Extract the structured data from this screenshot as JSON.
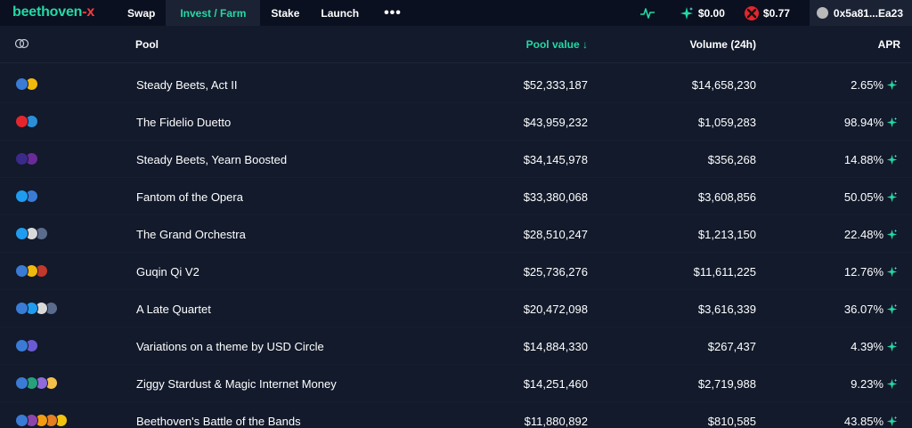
{
  "brand": {
    "part1": "beethoven",
    "part2": "-x"
  },
  "nav": [
    {
      "label": "Swap",
      "active": false
    },
    {
      "label": "Invest / Farm",
      "active": true
    },
    {
      "label": "Stake",
      "active": false
    },
    {
      "label": "Launch",
      "active": false
    }
  ],
  "nav_more": "•••",
  "tools": {
    "rewards": "$0.00",
    "beets_price": "$0.77",
    "wallet": "0x5a81...Ea23"
  },
  "colors": {
    "accent": "#24d9a4",
    "brand_x": "#ff3b3b",
    "background": "#0b1020",
    "panel": "#121a2b"
  },
  "columns": {
    "pool": "Pool",
    "pool_value": "Pool value ↓",
    "volume": "Volume (24h)",
    "apr": "APR"
  },
  "pools": [
    {
      "name": "Steady Beets, Act II",
      "value": "$52,333,187",
      "volume": "$14,658,230",
      "apr": "2.65%",
      "tokens": [
        "#3a7bd5",
        "#f0b90b"
      ]
    },
    {
      "name": "The Fidelio Duetto",
      "value": "$43,959,232",
      "volume": "$1,059,283",
      "apr": "98.94%",
      "tokens": [
        "#e3262d",
        "#2b8ed8"
      ]
    },
    {
      "name": "Steady Beets, Yearn Boosted",
      "value": "$34,145,978",
      "volume": "$356,268",
      "apr": "14.88%",
      "tokens": [
        "#3b2a8a",
        "#6a2a9a"
      ]
    },
    {
      "name": "Fantom of the Opera",
      "value": "$33,380,068",
      "volume": "$3,608,856",
      "apr": "50.05%",
      "tokens": [
        "#1f9cf0",
        "#3a7bd5"
      ]
    },
    {
      "name": "The Grand Orchestra",
      "value": "$28,510,247",
      "volume": "$1,213,150",
      "apr": "22.48%",
      "tokens": [
        "#1f9cf0",
        "#d9d9d9",
        "#5a6b8c"
      ]
    },
    {
      "name": "Guqin Qi V2",
      "value": "$25,736,276",
      "volume": "$11,611,225",
      "apr": "12.76%",
      "tokens": [
        "#3a7bd5",
        "#f0b90b",
        "#c0392b"
      ]
    },
    {
      "name": "A Late Quartet",
      "value": "$20,472,098",
      "volume": "$3,616,339",
      "apr": "36.07%",
      "tokens": [
        "#3a7bd5",
        "#1f9cf0",
        "#d9d9d9",
        "#5a6b8c"
      ]
    },
    {
      "name": "Variations on a theme by USD Circle",
      "value": "$14,884,330",
      "volume": "$267,437",
      "apr": "4.39%",
      "tokens": [
        "#3a7bd5",
        "#6b5bd2"
      ]
    },
    {
      "name": "Ziggy Stardust & Magic Internet Money",
      "value": "$14,251,460",
      "volume": "$2,719,988",
      "apr": "9.23%",
      "tokens": [
        "#3a7bd5",
        "#26a17b",
        "#8e6bd8",
        "#f5c04a"
      ]
    },
    {
      "name": "Beethoven's Battle of the Bands",
      "value": "$11,880,892",
      "volume": "$810,585",
      "apr": "43.85%",
      "tokens": [
        "#3a7bd5",
        "#8e44ad",
        "#f39c12",
        "#e67e22",
        "#f1c40f"
      ]
    }
  ]
}
